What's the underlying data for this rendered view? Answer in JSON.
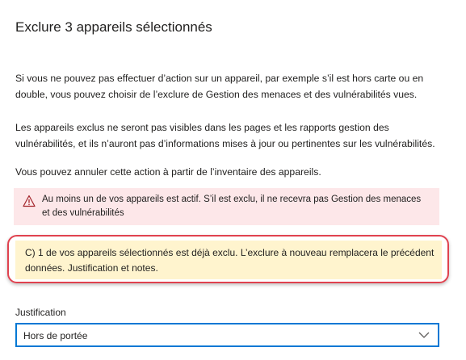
{
  "dialog": {
    "title": "Exclure 3 appareils sélectionnés",
    "paragraphs": [
      "Si vous ne pouvez pas effectuer d’action sur un appareil, par exemple s’il est hors carte ou en double, vous pouvez choisir de l’exclure de Gestion des menaces et des vulnérabilités vues.",
      "Les appareils exclus ne seront pas visibles dans les pages et les rapports gestion des vulnérabilités, et ils n’auront pas d’informations mises à jour ou pertinentes sur les vulnérabilités.",
      "Vous pouvez annuler cette action à partir de l’inventaire des appareils."
    ],
    "warning": {
      "icon": "warning-triangle-icon",
      "text": "Au moins un de vos appareils est actif. S’il est exclu, il ne recevra pas Gestion des menaces et des vulnérabilités",
      "background": "#fde7e9",
      "icon_color": "#a4262c"
    },
    "info": {
      "text": "C) 1 de vos appareils sélectionnés est déjà exclu. L’exclure à nouveau remplacera le précédent données. Justification et notes.",
      "background": "#fff4ce",
      "highlight_color": "#e0424f"
    },
    "justification": {
      "label": "Justification",
      "selected": "Hors de portée",
      "icon": "chevron-down-icon",
      "border_color": "#0078d4"
    }
  }
}
